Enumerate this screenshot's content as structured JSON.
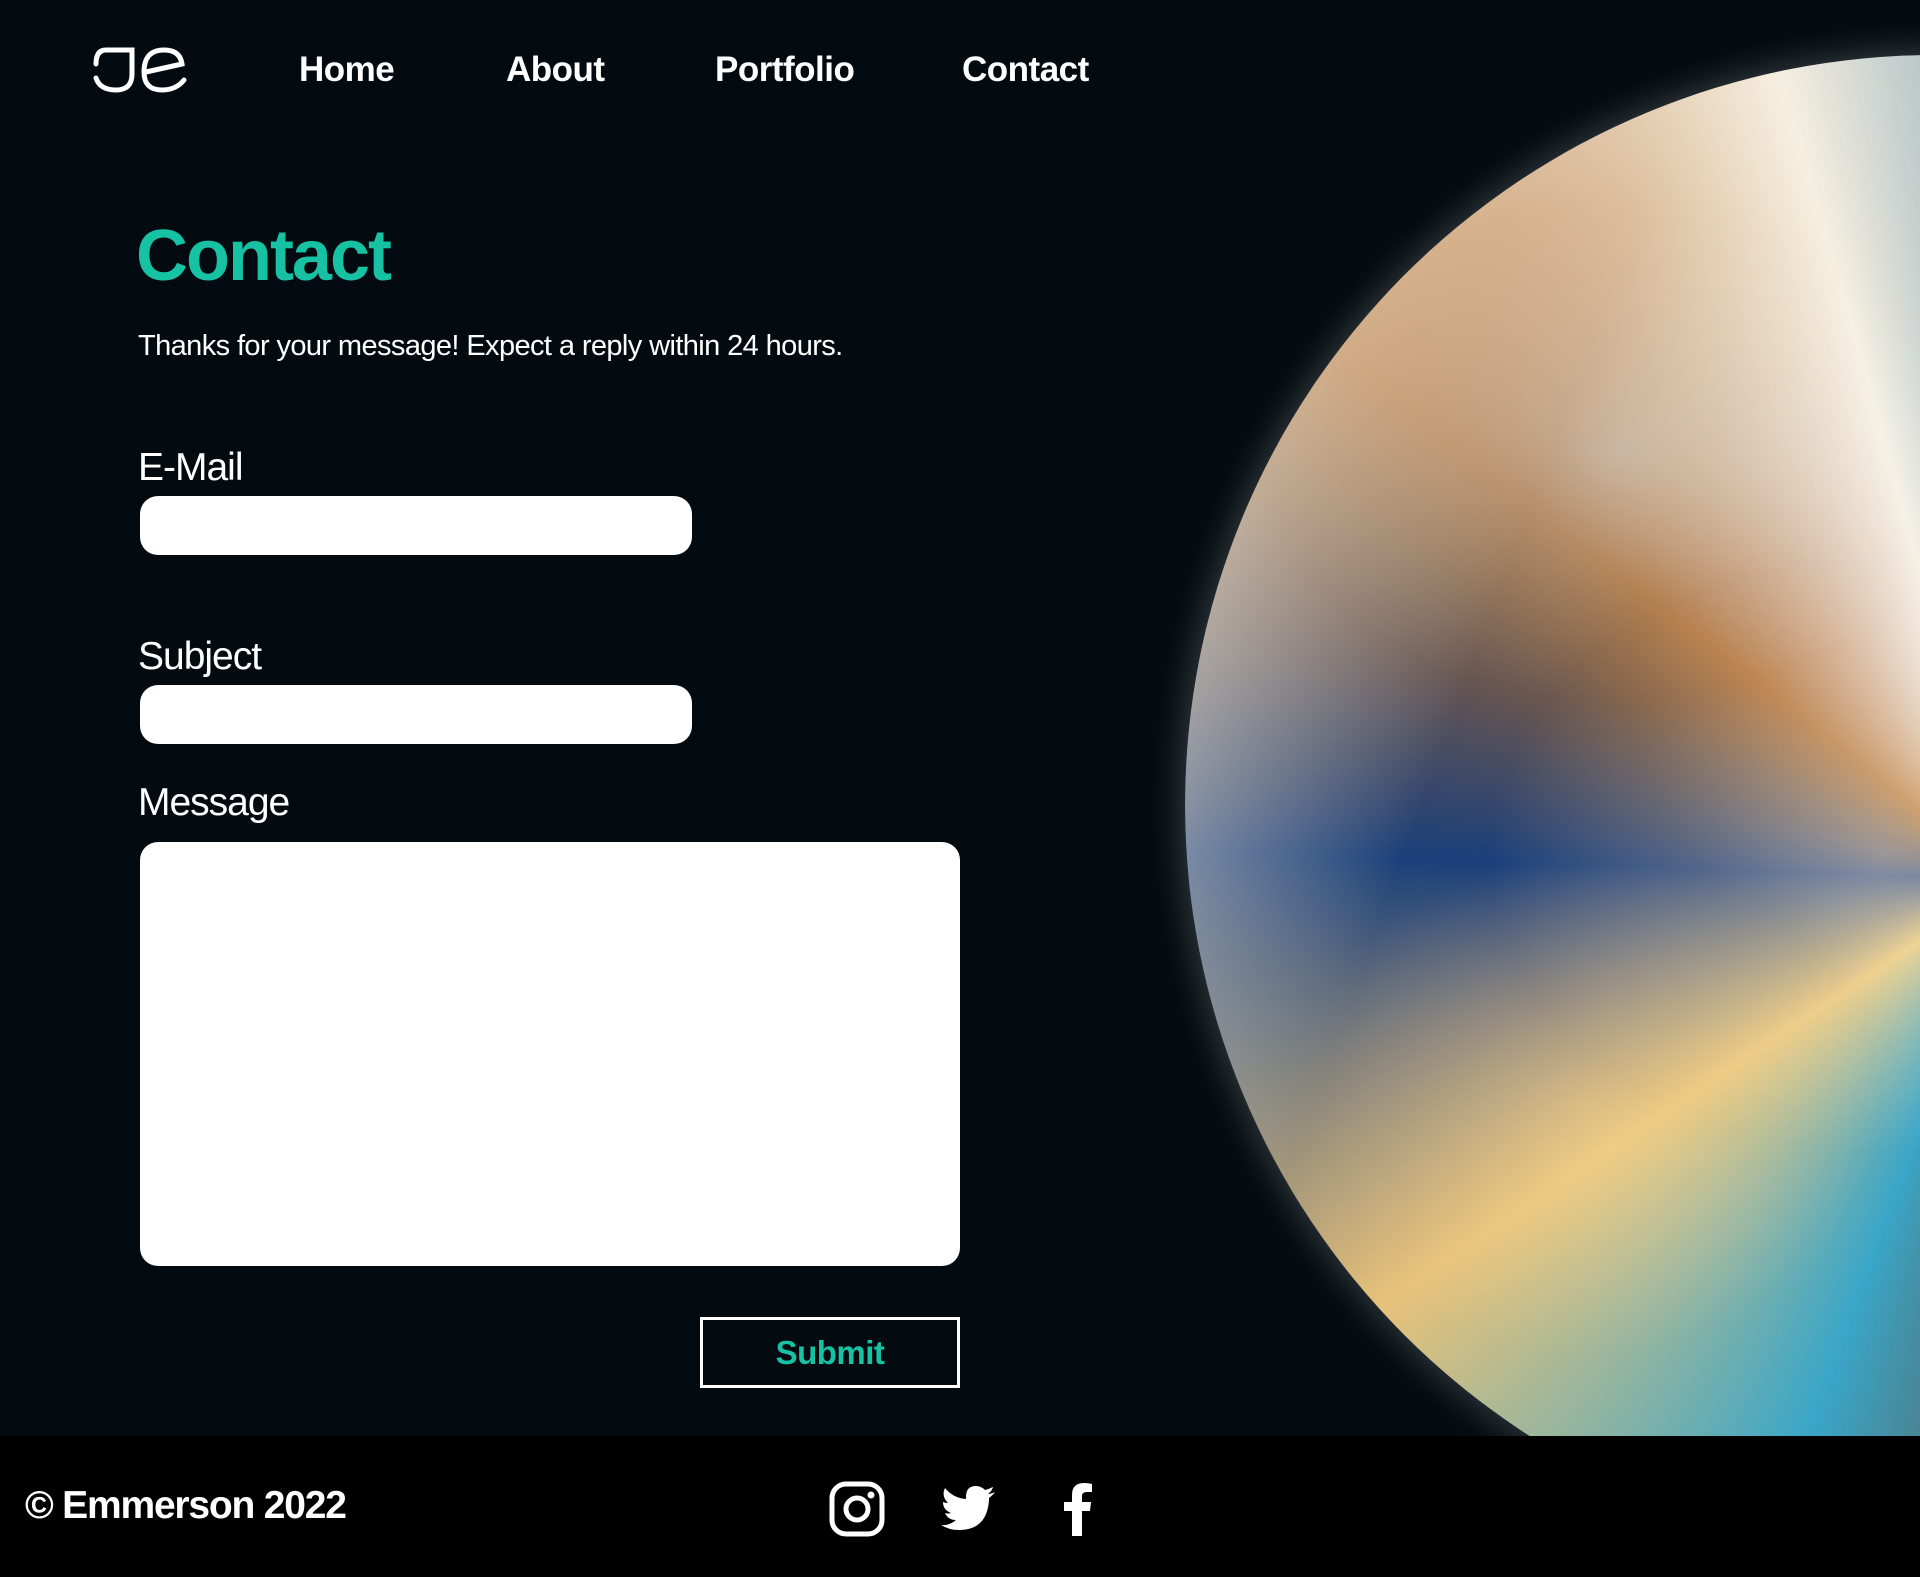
{
  "nav": {
    "logo_label": "JE",
    "links": [
      "Home",
      "About",
      "Portfolio",
      "Contact"
    ]
  },
  "page": {
    "title": "Contact",
    "confirmation": "Thanks for your message! Expect a reply within 24 hours."
  },
  "form": {
    "email_label": "E-Mail",
    "email_value": "",
    "subject_label": "Subject",
    "subject_value": "",
    "message_label": "Message",
    "message_value": "",
    "submit_label": "Submit"
  },
  "footer": {
    "copyright": "© Emmerson 2022",
    "social_icons": [
      "instagram-icon",
      "twitter-icon",
      "facebook-icon"
    ]
  },
  "colors": {
    "background": "#030b10",
    "accent": "#16c2a3",
    "footer": "#000000"
  }
}
